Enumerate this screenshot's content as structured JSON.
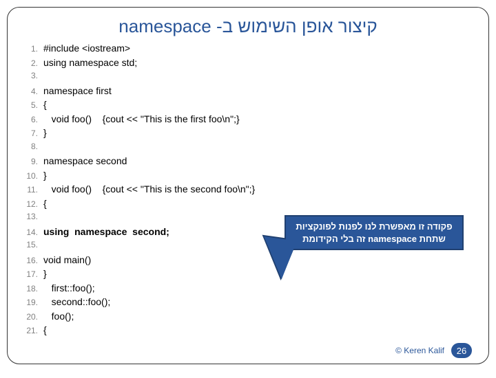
{
  "title": "קיצור אופן השימוש ב- namespace",
  "code_lines": [
    {
      "n": "1.",
      "text": "#include <iostream>",
      "bold": false
    },
    {
      "n": "2.",
      "text": "using namespace std;",
      "bold": false
    },
    {
      "n": "3.",
      "text": "",
      "bold": false
    },
    {
      "n": "4.",
      "text": "namespace first",
      "bold": false
    },
    {
      "n": "5.",
      "text": "{",
      "bold": false
    },
    {
      "n": "6.",
      "text": "   void foo()    {cout << \"This is the first foo\\n\";}",
      "bold": false
    },
    {
      "n": "7.",
      "text": "}",
      "bold": false
    },
    {
      "n": "8.",
      "text": "",
      "bold": false
    },
    {
      "n": "9.",
      "text": "namespace second",
      "bold": false
    },
    {
      "n": "10.",
      "text": "}",
      "bold": false
    },
    {
      "n": "11.",
      "text": "   void foo()    {cout << \"This is the second foo\\n\";}",
      "bold": false
    },
    {
      "n": "12.",
      "text": "{",
      "bold": false
    },
    {
      "n": "13.",
      "text": "",
      "bold": false
    },
    {
      "n": "14.",
      "text": "using  namespace  second;",
      "bold": true
    },
    {
      "n": "15.",
      "text": "",
      "bold": false
    },
    {
      "n": "16.",
      "text": "void main()",
      "bold": false
    },
    {
      "n": "17.",
      "text": "}",
      "bold": false
    },
    {
      "n": "18.",
      "text": "   first::foo();",
      "bold": false
    },
    {
      "n": "19.",
      "text": "   second::foo();",
      "bold": false
    },
    {
      "n": "20.",
      "text": "   foo();",
      "bold": false
    },
    {
      "n": "21.",
      "text": "{",
      "bold": false
    }
  ],
  "callout": {
    "line1": "פקודה זו מאפשרת לנו לפנות לפונקציות",
    "line2": "שתחת namespace זה בלי הקידומת"
  },
  "footer": {
    "copyright": "© Keren Kalif",
    "page": "26"
  }
}
